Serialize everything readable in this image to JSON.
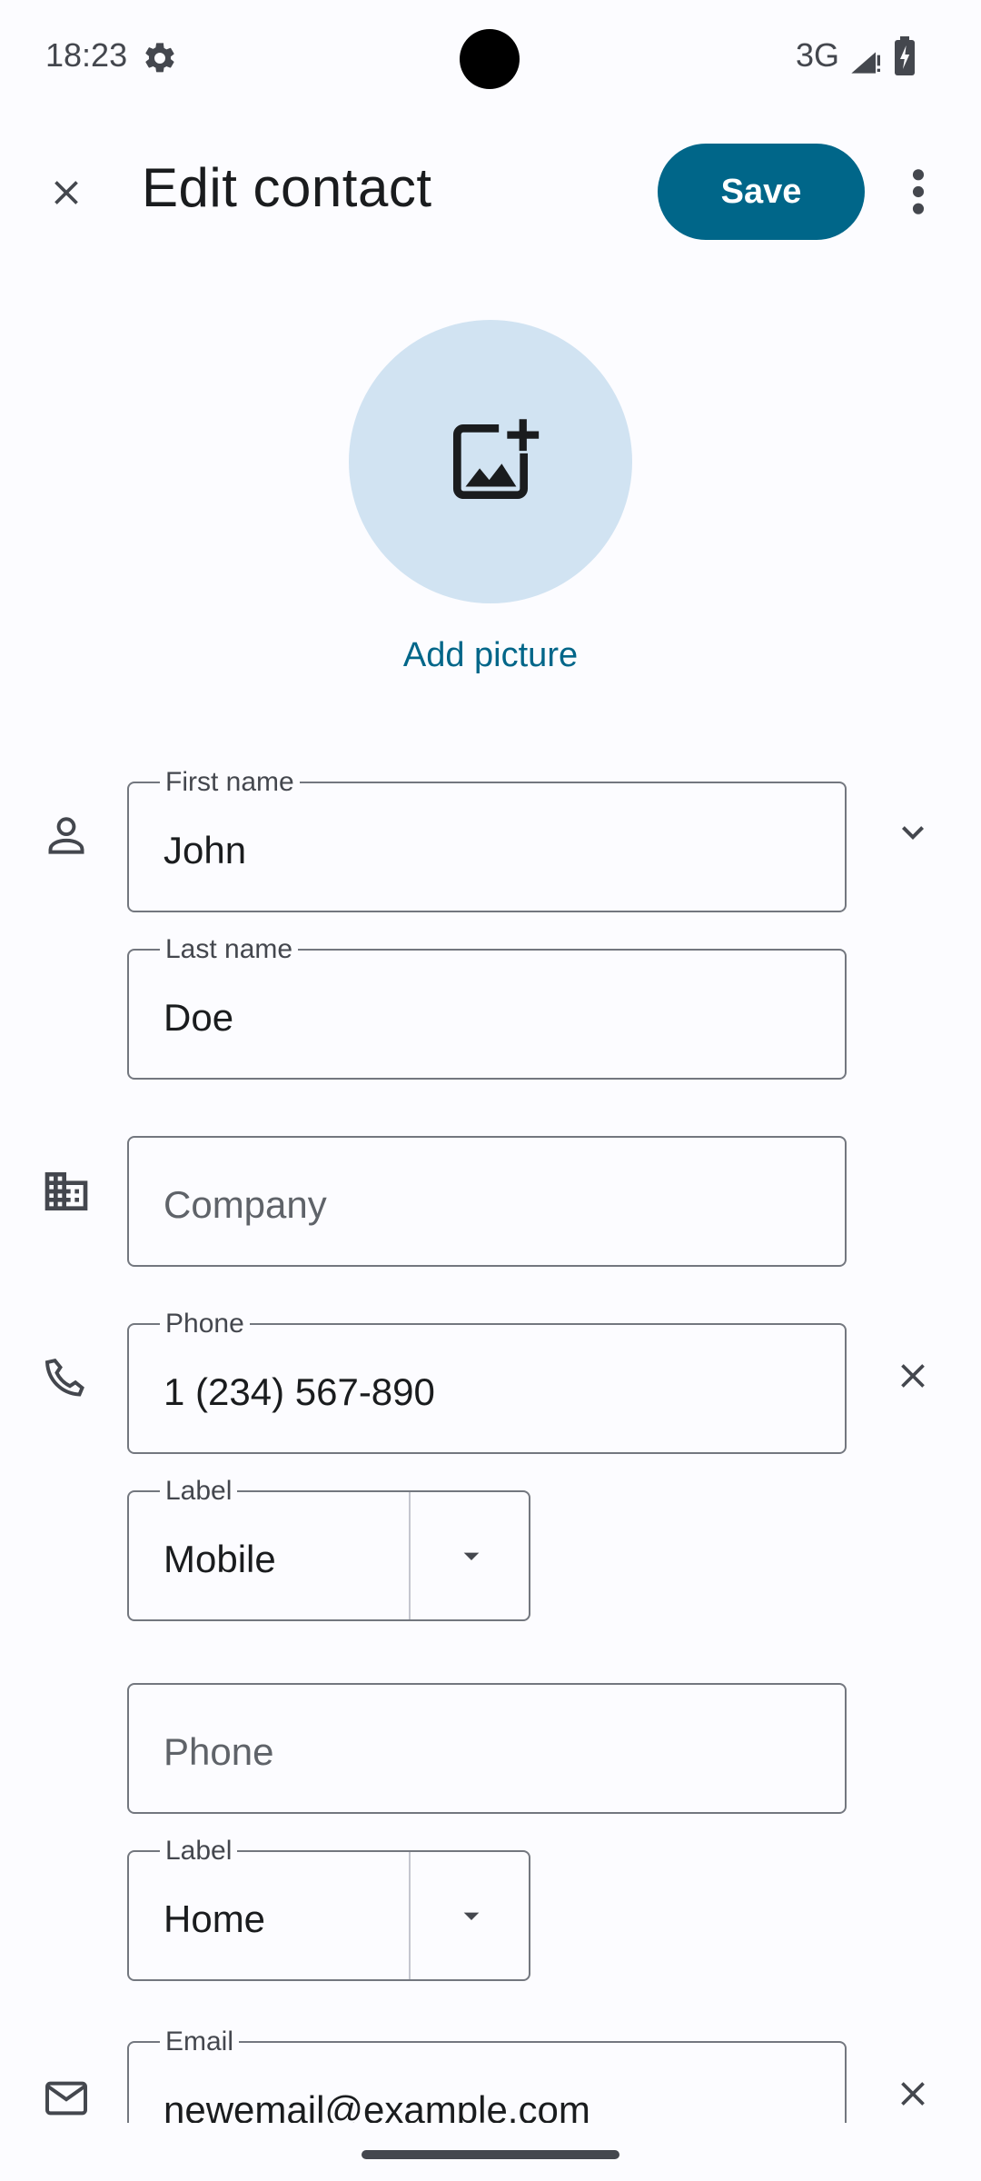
{
  "status_bar": {
    "time": "18:23",
    "network": "3G",
    "icons": [
      "settings-icon",
      "signal-icon",
      "battery-charging-icon"
    ]
  },
  "app_bar": {
    "title": "Edit contact",
    "save_label": "Save",
    "icons": [
      "close-icon",
      "more-vert-icon"
    ]
  },
  "picture": {
    "add_label": "Add picture",
    "icon": "add-photo-icon"
  },
  "name": {
    "first_label": "First name",
    "first_value": "John",
    "last_label": "Last name",
    "last_value": "Doe"
  },
  "company": {
    "placeholder": "Company"
  },
  "phones": [
    {
      "label": "Phone",
      "value": "1 (234) 567-890",
      "type_label": "Label",
      "type_value": "Mobile"
    },
    {
      "placeholder": "Phone",
      "type_label": "Label",
      "type_value": "Home"
    }
  ],
  "email": {
    "label": "Email",
    "value": "newemail@example.com"
  },
  "colors": {
    "accent": "#006689",
    "avatar_bg": "#d1e3f2",
    "background": "#fcfcff",
    "outline": "#73777f"
  }
}
